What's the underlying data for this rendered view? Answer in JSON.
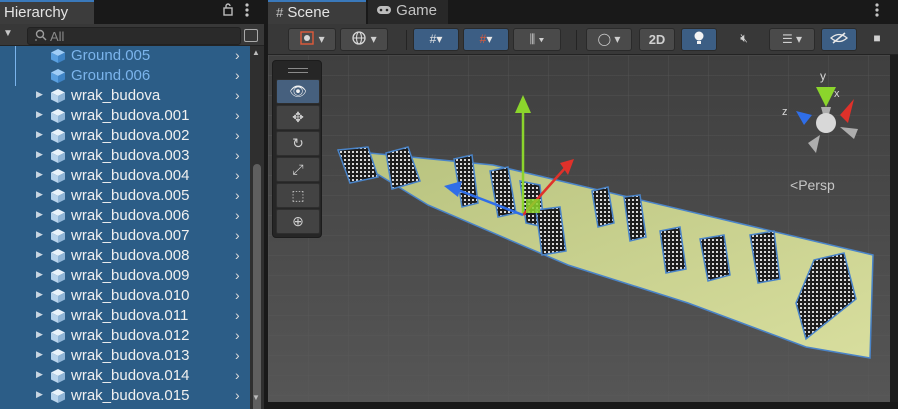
{
  "hierarchy": {
    "title": "Hierarchy",
    "search_placeholder": "All",
    "icons": {
      "lock": "lock-icon",
      "menu": "kebab-menu-icon",
      "add": "plus-dropdown-icon",
      "search": "search-icon"
    },
    "items": [
      {
        "label": "Ground.005",
        "prefab_color": "blue",
        "expandable": false
      },
      {
        "label": "Ground.006",
        "prefab_color": "blue",
        "expandable": false
      },
      {
        "label": "wrak_budova",
        "expandable": true
      },
      {
        "label": "wrak_budova.001",
        "expandable": true
      },
      {
        "label": "wrak_budova.002",
        "expandable": true
      },
      {
        "label": "wrak_budova.003",
        "expandable": true
      },
      {
        "label": "wrak_budova.004",
        "expandable": true
      },
      {
        "label": "wrak_budova.005",
        "expandable": true
      },
      {
        "label": "wrak_budova.006",
        "expandable": true
      },
      {
        "label": "wrak_budova.007",
        "expandable": true
      },
      {
        "label": "wrak_budova.008",
        "expandable": true
      },
      {
        "label": "wrak_budova.009",
        "expandable": true
      },
      {
        "label": "wrak_budova.010",
        "expandable": true
      },
      {
        "label": "wrak_budova.011",
        "expandable": true
      },
      {
        "label": "wrak_budova.012",
        "expandable": true
      },
      {
        "label": "wrak_budova.013",
        "expandable": true
      },
      {
        "label": "wrak_budova.014",
        "expandable": true
      },
      {
        "label": "wrak_budova.015",
        "expandable": true
      }
    ]
  },
  "scene": {
    "tabs": [
      {
        "label": "Scene",
        "icon": "grid-icon",
        "active": true
      },
      {
        "label": "Game",
        "icon": "gamepad-icon",
        "active": false
      }
    ],
    "toolbar": {
      "mode_2d_label": "2D",
      "buttons": [
        "draw-mode-icon",
        "global-local-icon",
        "grid-snap-icon",
        "snap-increment-icon",
        "vertex-snap-icon",
        "shading-icon",
        "2d-toggle",
        "lighting-icon",
        "audio-mute-icon",
        "effects-icon",
        "scene-visibility-icon",
        "camera-icon"
      ]
    },
    "tools": [
      "view-tool-icon",
      "move-tool-icon",
      "rotate-tool-icon",
      "scale-tool-icon",
      "rect-tool-icon",
      "transform-tool-icon"
    ],
    "active_tool": "view",
    "gizmo": {
      "axes": [
        "y",
        "x",
        "z"
      ],
      "projection_label": "Persp"
    }
  },
  "colors": {
    "selection": "#2c5d87",
    "accent": "#3a79bb",
    "prefab_blue": "#7bb4ec",
    "axis_x": "#e0312a",
    "axis_y": "#8bd52c",
    "axis_z": "#2f6ee8"
  }
}
